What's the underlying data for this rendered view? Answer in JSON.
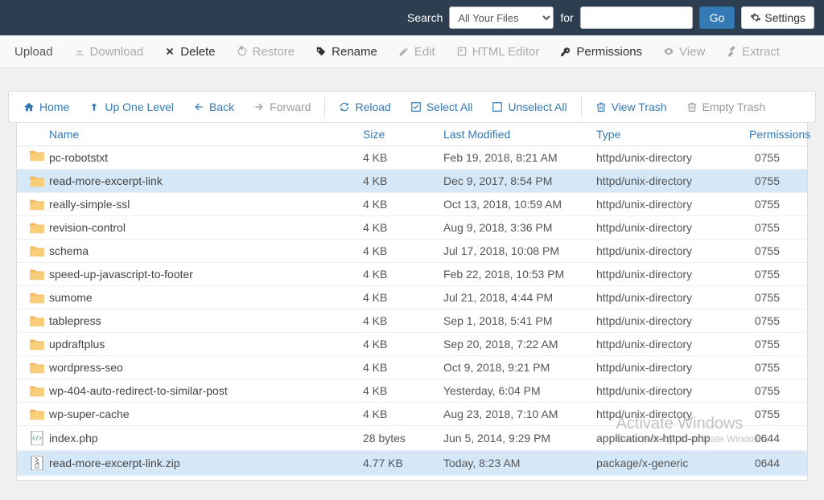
{
  "topbar": {
    "search_label": "Search",
    "scope_options": [
      "All Your Files"
    ],
    "scope_selected": "All Your Files",
    "for_label": "for",
    "go_label": "Go",
    "settings_label": "Settings"
  },
  "toolbar": {
    "upload": "Upload",
    "download": "Download",
    "delete": "Delete",
    "restore": "Restore",
    "rename": "Rename",
    "edit": "Edit",
    "html_editor": "HTML Editor",
    "permissions": "Permissions",
    "view": "View",
    "extract": "Extract"
  },
  "nav": {
    "home": "Home",
    "up": "Up One Level",
    "back": "Back",
    "forward": "Forward",
    "reload": "Reload",
    "select_all": "Select All",
    "unselect_all": "Unselect All",
    "view_trash": "View Trash",
    "empty_trash": "Empty Trash"
  },
  "columns": {
    "name": "Name",
    "size": "Size",
    "modified": "Last Modified",
    "type": "Type",
    "permissions": "Permissions"
  },
  "rows": [
    {
      "icon": "folder",
      "name": "pc-robotstxt",
      "size": "4 KB",
      "modified": "Feb 19, 2018, 8:21 AM",
      "type": "httpd/unix-directory",
      "perm": "0755",
      "sel": false
    },
    {
      "icon": "folder",
      "name": "read-more-excerpt-link",
      "size": "4 KB",
      "modified": "Dec 9, 2017, 8:54 PM",
      "type": "httpd/unix-directory",
      "perm": "0755",
      "sel": true
    },
    {
      "icon": "folder",
      "name": "really-simple-ssl",
      "size": "4 KB",
      "modified": "Oct 13, 2018, 10:59 AM",
      "type": "httpd/unix-directory",
      "perm": "0755",
      "sel": false
    },
    {
      "icon": "folder",
      "name": "revision-control",
      "size": "4 KB",
      "modified": "Aug 9, 2018, 3:36 PM",
      "type": "httpd/unix-directory",
      "perm": "0755",
      "sel": false
    },
    {
      "icon": "folder",
      "name": "schema",
      "size": "4 KB",
      "modified": "Jul 17, 2018, 10:08 PM",
      "type": "httpd/unix-directory",
      "perm": "0755",
      "sel": false
    },
    {
      "icon": "folder",
      "name": "speed-up-javascript-to-footer",
      "size": "4 KB",
      "modified": "Feb 22, 2018, 10:53 PM",
      "type": "httpd/unix-directory",
      "perm": "0755",
      "sel": false
    },
    {
      "icon": "folder",
      "name": "sumome",
      "size": "4 KB",
      "modified": "Jul 21, 2018, 4:44 PM",
      "type": "httpd/unix-directory",
      "perm": "0755",
      "sel": false
    },
    {
      "icon": "folder",
      "name": "tablepress",
      "size": "4 KB",
      "modified": "Sep 1, 2018, 5:41 PM",
      "type": "httpd/unix-directory",
      "perm": "0755",
      "sel": false
    },
    {
      "icon": "folder",
      "name": "updraftplus",
      "size": "4 KB",
      "modified": "Sep 20, 2018, 7:22 AM",
      "type": "httpd/unix-directory",
      "perm": "0755",
      "sel": false
    },
    {
      "icon": "folder",
      "name": "wordpress-seo",
      "size": "4 KB",
      "modified": "Oct 9, 2018, 9:21 PM",
      "type": "httpd/unix-directory",
      "perm": "0755",
      "sel": false
    },
    {
      "icon": "folder",
      "name": "wp-404-auto-redirect-to-similar-post",
      "size": "4 KB",
      "modified": "Yesterday, 6:04 PM",
      "type": "httpd/unix-directory",
      "perm": "0755",
      "sel": false
    },
    {
      "icon": "folder",
      "name": "wp-super-cache",
      "size": "4 KB",
      "modified": "Aug 23, 2018, 7:10 AM",
      "type": "httpd/unix-directory",
      "perm": "0755",
      "sel": false
    },
    {
      "icon": "code",
      "name": "index.php",
      "size": "28 bytes",
      "modified": "Jun 5, 2014, 9:29 PM",
      "type": "application/x-httpd-php",
      "perm": "0644",
      "sel": false
    },
    {
      "icon": "zip",
      "name": "read-more-excerpt-link.zip",
      "size": "4.77 KB",
      "modified": "Today, 8:23 AM",
      "type": "package/x-generic",
      "perm": "0644",
      "sel": true
    }
  ],
  "watermark": {
    "line1": "Activate Windows",
    "line2": "Go to Settings to activate Windows."
  }
}
